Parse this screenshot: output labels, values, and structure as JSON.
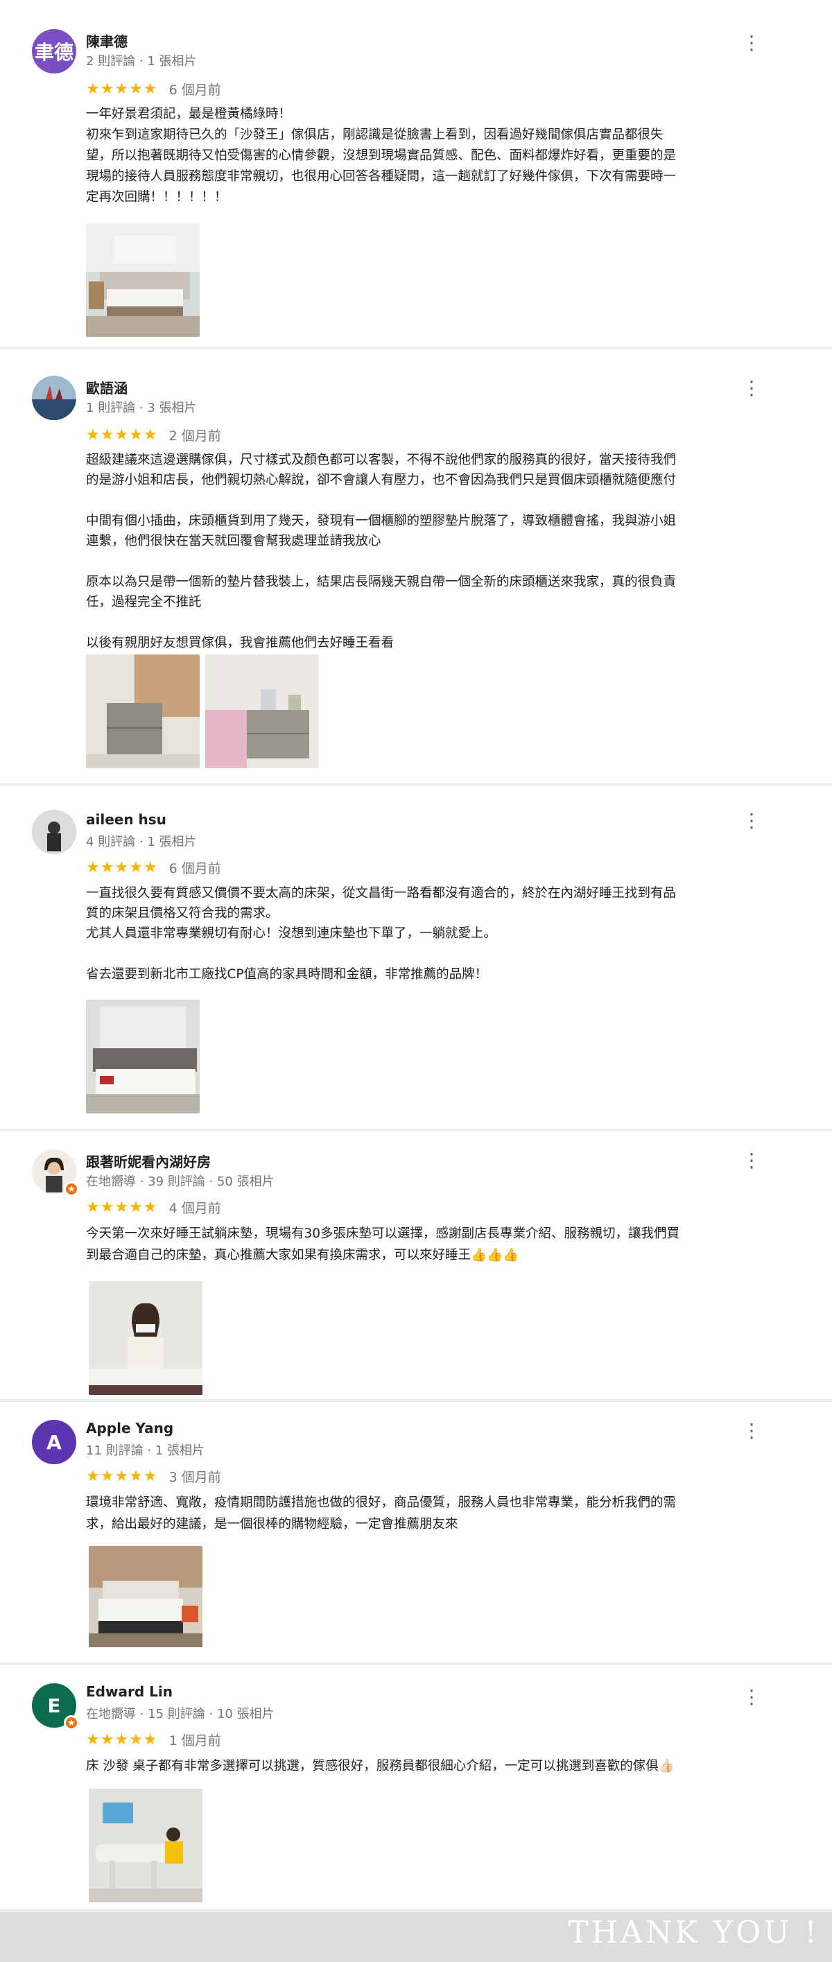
{
  "reviews": [
    {
      "avatar_text": "聿德",
      "avatar_color": "#7b4fc4",
      "name": "陳聿德",
      "meta": "2 則評論 · 1 張相片",
      "stars": "★★★★★",
      "when": "6 個月前",
      "lines": [
        "一年好景君須記，最是橙黃橘綠時！",
        "初來乍到這家期待已久的「沙發王」傢俱店，剛認識是從臉書上看到，因看過好幾間傢俱店實品都很失",
        "望，所以抱著既期待又怕受傷害的心情參觀，沒想到現場實品質感、配色、面料都爆炸好看，更重要的是",
        "現場的接待人員服務態度非常親切，也很用心回答各種疑問，這一趟就訂了好幾件傢俱，下次有需要時一",
        "定再次回購！！！！！！"
      ],
      "photo_alt": "店內展示床組照片"
    },
    {
      "name": "歐語涵",
      "meta": "1 則評論 · 3 張相片",
      "stars": "★★★★★",
      "when": "2 個月前",
      "lines": [
        "超級建議來這邊選購傢俱，尺寸樣式及顏色都可以客製，不得不說他們家的服務真的很好，當天接待我們",
        "的是游小姐和店長，他們親切熱心解說，卻不會讓人有壓力，也不會因為我們只是買個床頭櫃就隨便應付",
        "",
        "中間有個小插曲，床頭櫃貨到用了幾天，發現有一個櫃腳的塑膠墊片脫落了，導致櫃體會搖，我與游小姐",
        "連繫，他們很快在當天就回覆會幫我處理並請我放心",
        "",
        "原本以為只是帶一個新的墊片替我裝上，結果店長隔幾天親自帶一個全新的床頭櫃送來我家，真的很負責",
        "任，過程完全不推託",
        "",
        "以後有親朋好友想買傢俱，我會推薦他們去好睡王看看"
      ]
    },
    {
      "name": "aileen hsu",
      "meta": "4 則評論 · 1 張相片",
      "stars": "★★★★★",
      "when": "6 個月前",
      "lines": [
        "一直找很久要有質感又價價不要太高的床架，從文昌街一路看都沒有適合的，終於在內湖好睡王找到有品",
        "質的床架且價格又符合我的需求。",
        "尤其人員還非常專業親切有耐心！沒想到連床墊也下單了，一躺就愛上。",
        "",
        "省去還要到新北市工廠找CP值高的家具時間和金額，非常推薦的品牌！"
      ]
    },
    {
      "name": "跟著昕妮看內湖好房",
      "meta": "在地嚮導 · 39 則評論 · 50 張相片",
      "stars": "★★★★★",
      "when": "4 個月前",
      "lines": [
        "今天第一次來好睡王試躺床墊，現場有30多張床墊可以選擇，感謝副店長專業介紹、服務親切，讓我們買",
        "到最合適自己的床墊，真心推薦大家如果有換床需求，可以來好睡王👍👍👍"
      ]
    },
    {
      "avatar_text": "A",
      "avatar_color": "#5e35b1",
      "name": "Apple Yang",
      "meta": "11 則評論 · 1 張相片",
      "stars": "★★★★★",
      "when": "3 個月前",
      "lines": [
        "環境非常舒適、寬敞，疫情期間防護措施也做的很好，商品優質，服務人員也非常專業，能分析我們的需",
        "求，給出最好的建議，是一個很棒的購物經驗，一定會推薦朋友來"
      ]
    },
    {
      "avatar_text": "E",
      "avatar_color": "#0b6b4f",
      "name": "Edward Lin",
      "meta": "在地嚮導 · 15 則評論 · 10 張相片",
      "stars": "★★★★★",
      "when": "1 個月前",
      "lines": [
        "床 沙發 桌子都有非常多選擇可以挑選，質感很好，服務員都很細心介紹，一定可以挑選到喜歡的傢俱👍🏻"
      ]
    }
  ],
  "more_icon": "⋮",
  "thank_you": "THANK YOU !"
}
